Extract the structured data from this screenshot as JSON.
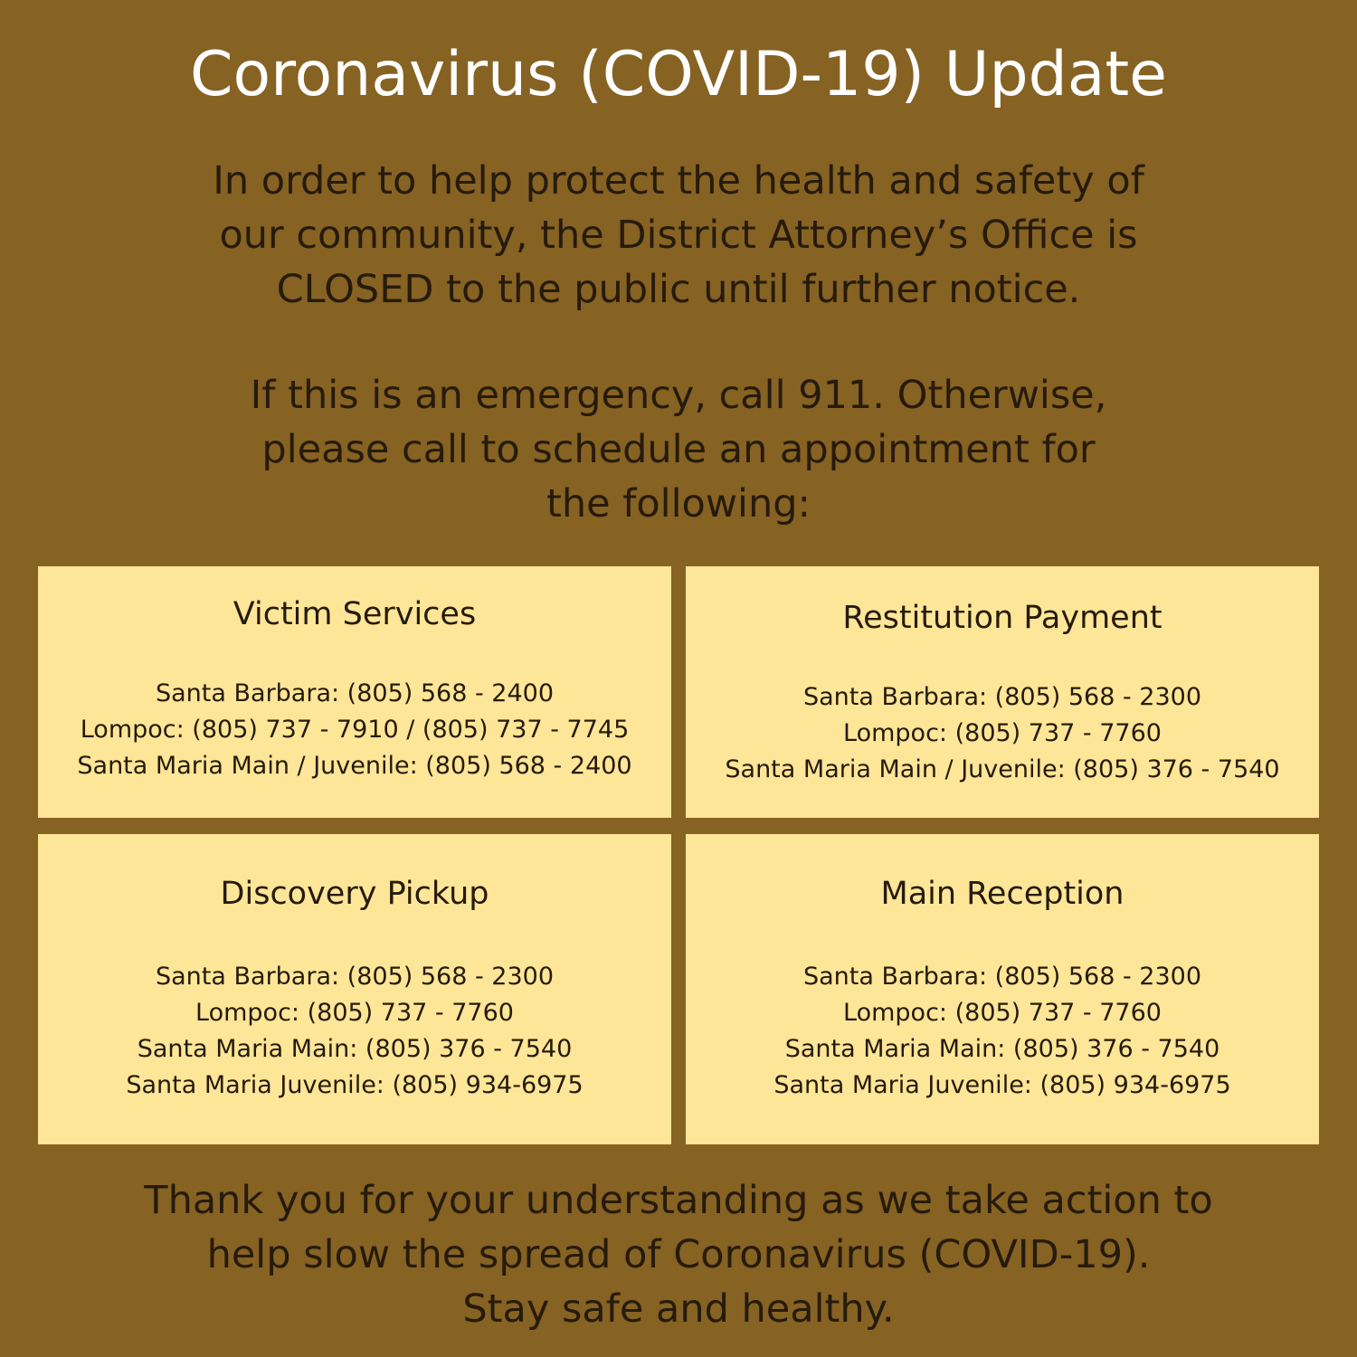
{
  "title": "Coronavirus (COVID-19) Update",
  "intro": [
    "In order to help protect the health and safety of",
    "our community, the District Attorney’s Office is",
    "CLOSED to the public until further notice."
  ],
  "emergency": [
    "If this is an emergency, call 911. Otherwise,",
    "please call to schedule an appointment for",
    "the following:"
  ],
  "cards": [
    {
      "title": "Victim Services",
      "lines": [
        "Santa Barbara: (805) 568 - 2400",
        "Lompoc: (805) 737 - 7910 / (805) 737 - 7745",
        "Santa Maria Main / Juvenile: (805) 568 - 2400"
      ]
    },
    {
      "title": "Restitution Payment",
      "lines": [
        "Santa Barbara: (805) 568 - 2300",
        "Lompoc: (805) 737 - 7760",
        "Santa Maria Main / Juvenile: (805) 376 - 7540"
      ]
    },
    {
      "title": "Discovery Pickup",
      "lines": [
        "Santa Barbara: (805) 568 - 2300",
        "Lompoc: (805) 737 - 7760",
        "Santa Maria Main: (805) 376 - 7540",
        "Santa Maria Juvenile: (805) 934-6975"
      ]
    },
    {
      "title": "Main Reception",
      "lines": [
        "Santa Barbara: (805) 568 - 2300",
        "Lompoc: (805) 737 - 7760",
        "Santa Maria Main: (805) 376 - 7540",
        "Santa Maria Juvenile: (805) 934-6975"
      ]
    }
  ],
  "closing": [
    "Thank you for your understanding as we take action to",
    "help slow the spread of Coronavirus (COVID-19).",
    "Stay safe and healthy."
  ],
  "colors": {
    "background": "#866223",
    "card": "#fee698",
    "title_text": "#ffffff",
    "body_text": "#261b0b"
  }
}
